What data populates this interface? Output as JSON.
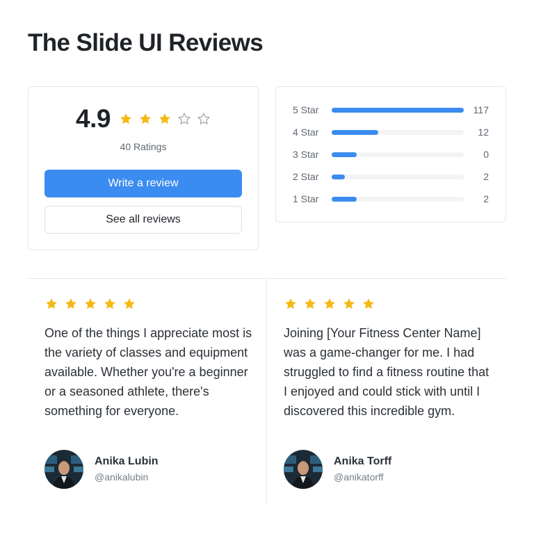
{
  "page": {
    "title": "The Slide UI Reviews"
  },
  "summary": {
    "score": "4.9",
    "stars_filled": 3,
    "stars_total": 5,
    "ratings_count": "40 Ratings",
    "write_review_label": "Write a review",
    "see_all_label": "See all reviews"
  },
  "distribution": [
    {
      "label": "5 Star",
      "count": "117",
      "fill_fraction": 1.0
    },
    {
      "label": "4 Star",
      "count": "12",
      "fill_fraction": 0.35
    },
    {
      "label": "3 Star",
      "count": "0",
      "fill_fraction": 0.19
    },
    {
      "label": "2 Star",
      "count": "2",
      "fill_fraction": 0.1
    },
    {
      "label": "1 Star",
      "count": "2",
      "fill_fraction": 0.19
    }
  ],
  "reviews": [
    {
      "stars": 5,
      "text": "One of the things I appreciate most is the variety of classes and equipment available. Whether you're a beginner or a seasoned athlete, there's something for everyone.",
      "name": "Anika Lubin",
      "handle": "@anikalubin"
    },
    {
      "stars": 5,
      "text": "Joining [Your Fitness Center Name] was a game-changer for me. I had struggled to find a fitness routine that I enjoyed and could stick with until I discovered this incredible gym.",
      "name": "Anika Torff",
      "handle": "@anikatorff"
    }
  ],
  "colors": {
    "accent": "#3b8cf0",
    "star_filled": "#f5b914",
    "star_empty": "#9aa0a6",
    "border": "#e3e6ea"
  },
  "icons": {
    "star": "star-icon",
    "star_outline": "star-outline-icon",
    "avatar": "avatar-image"
  }
}
